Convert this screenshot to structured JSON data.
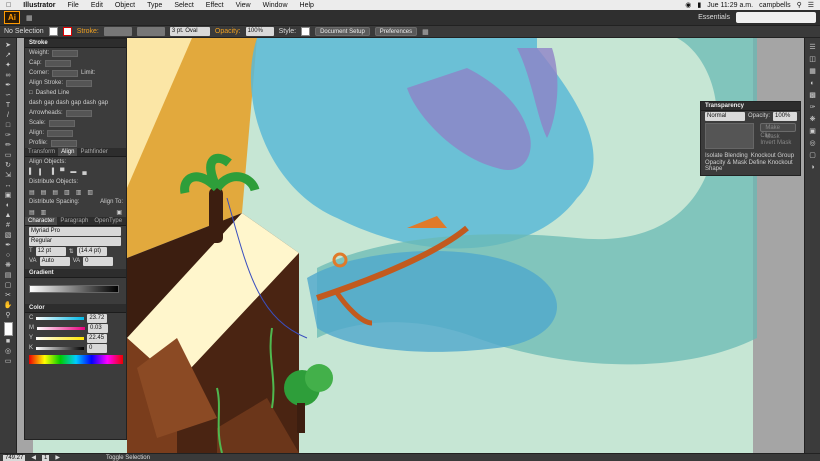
{
  "menubar": {
    "apple": "",
    "app_name": "Illustrator",
    "items": [
      "File",
      "Edit",
      "Object",
      "Type",
      "Select",
      "Effect",
      "View",
      "Window",
      "Help"
    ],
    "clock": "Jue 11:29 a.m.",
    "user": "campbells"
  },
  "appbar": {
    "logo": "Ai",
    "workspace": "Essentials",
    "search_placeholder": ""
  },
  "control": {
    "selection": "No Selection",
    "stroke_label": "Stroke:",
    "brush": "3 pt. Oval",
    "opacity_label": "Opacity:",
    "opacity_value": "100%",
    "style_label": "Style:",
    "document_setup": "Document Setup",
    "preferences": "Preferences"
  },
  "stroke_panel": {
    "title": "Stroke",
    "weight": "Weight:",
    "cap": "Cap:",
    "corner": "Corner:",
    "limit": "Limit:",
    "align": "Align Stroke:",
    "dashed": "Dashed Line",
    "dash_labels": [
      "dash",
      "gap",
      "dash",
      "gap",
      "dash",
      "gap"
    ],
    "arrowheads": "Arrowheads:",
    "scale": "Scale:",
    "align2": "Align:",
    "profile": "Profile:"
  },
  "align_panel": {
    "tabs": [
      "Transform",
      "Align",
      "Pathfinder"
    ],
    "align_objects": "Align Objects:",
    "distribute_objects": "Distribute Objects:",
    "distribute_spacing": "Distribute Spacing:",
    "align_to": "Align To:"
  },
  "character_panel": {
    "tabs": [
      "Character",
      "Paragraph",
      "OpenType"
    ],
    "font": "Myriad Pro",
    "style": "Regular",
    "size": "12 pt",
    "leading": "(14.4 pt)",
    "kerning": "Auto",
    "tracking": "0"
  },
  "gradient_panel": {
    "title": "Gradient"
  },
  "color_panel": {
    "title": "Color",
    "channels": [
      {
        "name": "C",
        "value": "23.72"
      },
      {
        "name": "M",
        "value": "0.03"
      },
      {
        "name": "Y",
        "value": "22.45"
      },
      {
        "name": "K",
        "value": "0"
      }
    ]
  },
  "transparency_panel": {
    "title": "Transparency",
    "mode": "Normal",
    "opacity_label": "Opacity:",
    "opacity_value": "100%",
    "make_mask": "Make Mask",
    "clip": "Clip",
    "invert": "Invert Mask",
    "isolate": "Isolate Blending",
    "knockout": "Knockout Group",
    "opacity_mask": "Opacity & Mask Define Knockout Shape"
  },
  "status": {
    "zoom": "749.27",
    "page": "1",
    "mode": "Toggle Selection"
  }
}
